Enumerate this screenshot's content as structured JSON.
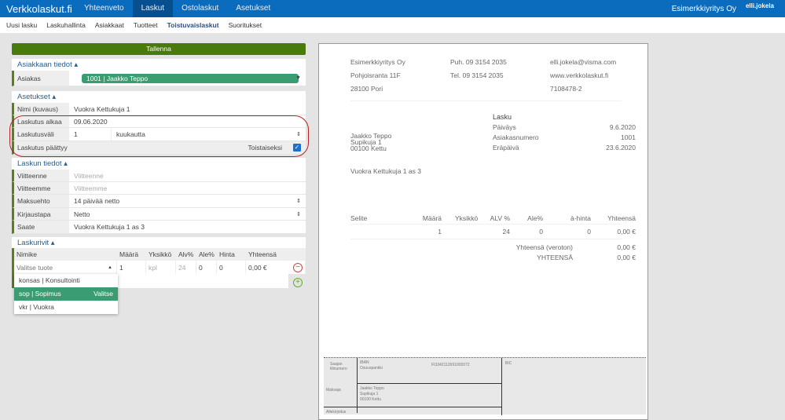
{
  "topbar": {
    "brand": "Verkkolaskut.fi",
    "nav": [
      "Yhteenveto",
      "Laskut",
      "Ostolaskut",
      "Asetukset"
    ],
    "active": "Laskut",
    "company": "Esimerkkiyritys Oy",
    "user": "elli.jokela"
  },
  "subnav": {
    "items": [
      "Uusi lasku",
      "Laskuhallinta",
      "Asiakkaat",
      "Tuotteet",
      "Toistuvaislaskut",
      "Suoritukset"
    ],
    "active": "Toistuvaislaskut"
  },
  "form": {
    "save_label": "Tallenna",
    "customer_section": "Asiakkaan tiedot",
    "customer_label": "Asiakas",
    "customer_value": "1001 | Jaakko Teppo",
    "settings_section": "Asetukset",
    "name_label": "Nimi (kuvaus)",
    "name_value": "Vuokra Kettukuja 1",
    "start_label": "Laskutus alkaa",
    "start_value": "09.06.2020",
    "interval_label": "Laskutusväli",
    "interval_value": "1",
    "interval_unit": "kuukautta",
    "end_label": "Laskutus päättyy",
    "end_value": "Toistaiseksi",
    "end_checked": true,
    "invoice_section": "Laskun tiedot",
    "ref1_label": "Viitteenne",
    "ref1_placeholder": "Viitteenne",
    "ref2_label": "Viitteemme",
    "ref2_placeholder": "Viitteemme",
    "terms_label": "Maksuehto",
    "terms_value": "14 päivää netto",
    "booking_label": "Kirjaustapa",
    "booking_value": "Netto",
    "note_label": "Saate",
    "note_value": "Vuokra Kettukuja 1 as 3",
    "rows_section": "Laskurivit",
    "columns": [
      "Nimike",
      "Määrä",
      "Yksikkö",
      "Alv%",
      "Ale%",
      "Hinta",
      "Yhteensä"
    ],
    "row": {
      "product_placeholder": "Valitse tuote",
      "qty": "1",
      "unit": "kpl",
      "vat": "24",
      "discount": "0",
      "price": "0",
      "total": "0,00 €"
    },
    "dropdown": [
      {
        "label": "konsas | Konsultointi"
      },
      {
        "label": "sop | Sopimus",
        "action": "Valitse",
        "selected": true
      },
      {
        "label": "vkr | Vuokra"
      }
    ]
  },
  "preview": {
    "sender": [
      "Esimerkkiyritys Oy",
      "Pohjoisranta 11F",
      "28100 Pori"
    ],
    "phones": [
      "Puh. 09 3154 2035",
      "Tel. 09 3154 2035"
    ],
    "contact": [
      "elli.jokela@visma.com",
      "www.verkkolaskut.fi",
      "7108478-2"
    ],
    "recipient": [
      "Jaakko Teppo",
      "Supikuja 1",
      "00100 Kettu"
    ],
    "title": "Lasku",
    "meta": [
      {
        "k": "Päiväys",
        "v": "9.6.2020"
      },
      {
        "k": "Asiakasnumero",
        "v": "1001"
      },
      {
        "k": "Eräpäivä",
        "v": "23.6.2020"
      }
    ],
    "note": "Vuokra Kettukuja 1 as 3",
    "columns": [
      "Selite",
      "Määrä",
      "Yksikkö",
      "ALV %",
      "Ale%",
      "à-hinta",
      "Yhteensä"
    ],
    "line": {
      "qty": "1",
      "vat": "24",
      "discount": "0",
      "price": "0",
      "total": "0,00 €"
    },
    "sum_label": "Yhteensä (veroton)",
    "sum_value": "0,00 €",
    "total_label": "YHTEENSÄ",
    "total_value": "0,00 €",
    "slip": {
      "iban_label": "IBAN",
      "bank": "Osuuspankki",
      "iban": "FI3342112691000072",
      "bic_label": "BIC",
      "payee_label": "Saajan tilinumero",
      "payer_label": "Maksaja",
      "payer": [
        "Jaakko Teppo",
        "Supikuja 1",
        "00100 Kettu"
      ],
      "sign_label": "Allekirjoitus"
    }
  }
}
